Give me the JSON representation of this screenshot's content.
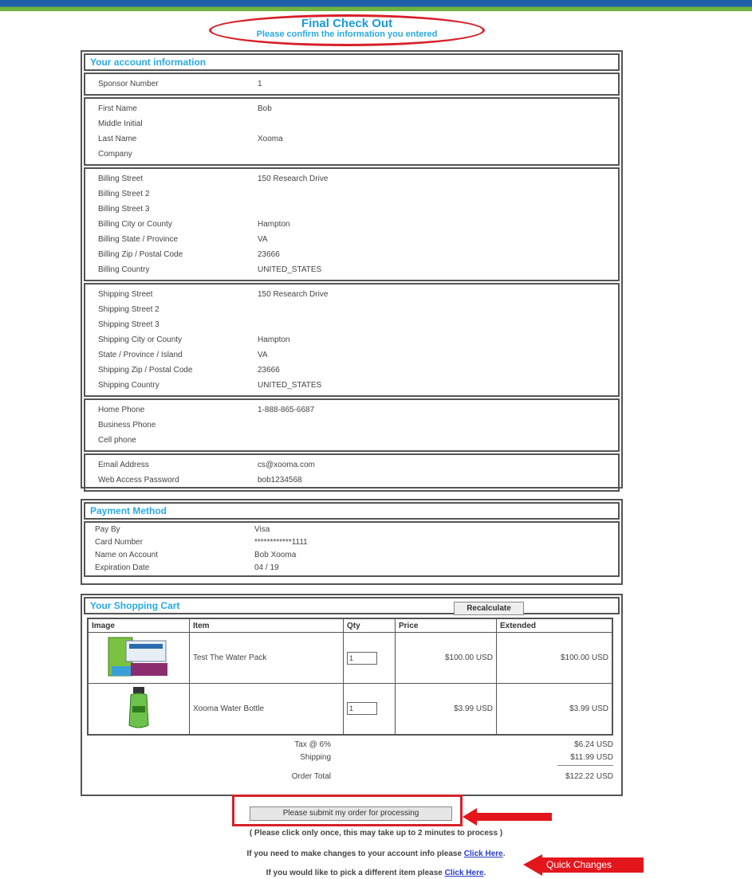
{
  "header": {
    "title": "Final Check Out",
    "subtitle": "Please confirm the information you entered"
  },
  "account": {
    "heading": "Your account information",
    "sponsor": [
      {
        "label": "Sponsor Number",
        "value": "1"
      }
    ],
    "name": [
      {
        "label": "First Name",
        "value": "Bob"
      },
      {
        "label": "Middle Initial",
        "value": ""
      },
      {
        "label": "Last Name",
        "value": "Xooma"
      },
      {
        "label": "Company",
        "value": ""
      }
    ],
    "billing": [
      {
        "label": "Billing Street",
        "value": "150 Research Drive"
      },
      {
        "label": "Billing Street 2",
        "value": ""
      },
      {
        "label": "Billing Street 3",
        "value": ""
      },
      {
        "label": "Billing City or County",
        "value": "Hampton"
      },
      {
        "label": "Billing State / Province",
        "value": "VA"
      },
      {
        "label": "Billing Zip / Postal Code",
        "value": "23666"
      },
      {
        "label": "Billing Country",
        "value": "UNITED_STATES"
      }
    ],
    "shipping": [
      {
        "label": "Shipping Street",
        "value": "150 Research Drive"
      },
      {
        "label": "Shipping Street 2",
        "value": ""
      },
      {
        "label": "Shipping Street 3",
        "value": ""
      },
      {
        "label": "Shipping City or County",
        "value": "Hampton"
      },
      {
        "label": "State / Province / Island",
        "value": "VA"
      },
      {
        "label": "Shipping Zip / Postal Code",
        "value": "23666"
      },
      {
        "label": "Shipping Country",
        "value": "UNITED_STATES"
      }
    ],
    "phones": [
      {
        "label": "Home Phone",
        "value": "1-888-865-6687"
      },
      {
        "label": "Business Phone",
        "value": ""
      },
      {
        "label": "Cell phone",
        "value": ""
      }
    ],
    "login": [
      {
        "label": "Email Address",
        "value": "cs@xooma.com"
      },
      {
        "label": "Web Access Password",
        "value": "bob1234568"
      }
    ]
  },
  "payment": {
    "heading": "Payment Method",
    "rows": [
      {
        "label": "Pay By",
        "value": "Visa"
      },
      {
        "label": "Card Number",
        "value": "************1111"
      },
      {
        "label": "Name on Account",
        "value": "Bob Xooma"
      },
      {
        "label": "Expiration Date",
        "value": "04 / 19"
      }
    ]
  },
  "cart": {
    "heading": "Your Shopping Cart",
    "recalculate_label": "Recalculate",
    "columns": [
      "Image",
      "Item",
      "Qty",
      "Price",
      "Extended"
    ],
    "items": [
      {
        "item": "Test The Water Pack",
        "qty": "1",
        "price": "$100.00 USD",
        "extended": "$100.00 USD",
        "image_icon": "water-pack-image"
      },
      {
        "item": "Xooma Water Bottle",
        "qty": "1",
        "price": "$3.99 USD",
        "extended": "$3.99 USD",
        "image_icon": "water-bottle-image"
      }
    ],
    "tax_label": "Tax @ 6%",
    "tax_value": "$6.24 USD",
    "shipping_label": "Shipping",
    "shipping_value": "$11.99 USD",
    "total_label": "Order Total",
    "total_value": "$122.22 USD"
  },
  "submit": {
    "button_label": "Please submit my order for processing",
    "note": "( Please click only once, this may take up to 2 minutes to process )",
    "change_info_text": "If you need to make changes to your account info please",
    "change_item_text": "If you would like to pick a different item please",
    "link_label": "Click Here",
    "callout": "Quick Changes"
  },
  "colors": {
    "accent": "#29aae1",
    "highlight_red": "#d8202a",
    "link": "#2a3bc9"
  }
}
